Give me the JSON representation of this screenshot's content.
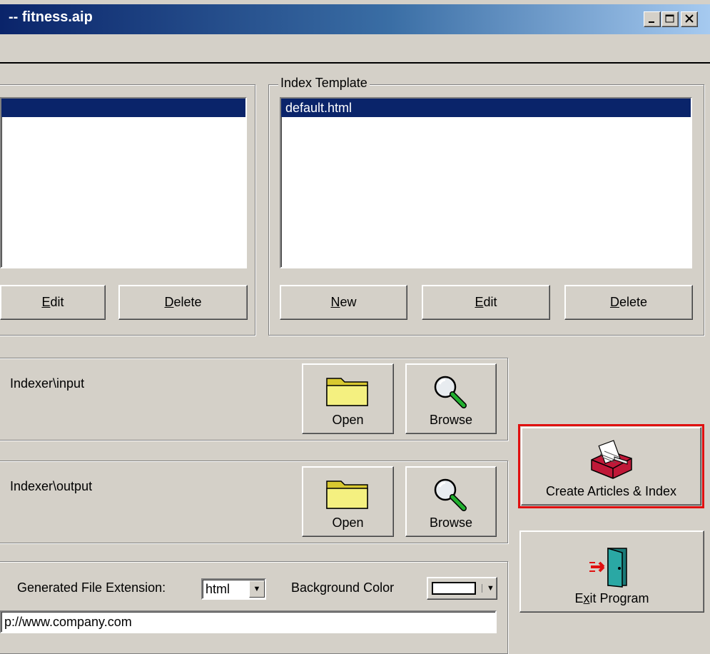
{
  "window": {
    "title": "-- fitness.aip"
  },
  "left_template": {
    "buttons": {
      "edit": {
        "ul": "E",
        "rest": "dit"
      },
      "delete": {
        "ul": "D",
        "rest": "elete"
      }
    }
  },
  "index_template": {
    "legend": "Index Template",
    "items": [
      "default.html"
    ],
    "selected": "default.html",
    "buttons": {
      "new": {
        "ul": "N",
        "rest": "ew"
      },
      "edit": {
        "ul": "E",
        "rest": "dit"
      },
      "delete": {
        "ul": "D",
        "rest": "elete"
      }
    }
  },
  "input_folder": {
    "path": "Indexer\\input",
    "open_label": "Open",
    "browse_label": "Browse"
  },
  "output_folder": {
    "path": "Indexer\\output",
    "open_label": "Open",
    "browse_label": "Browse"
  },
  "settings": {
    "ext_label": "Generated File Extension:",
    "ext_value": "html",
    "bg_color_label": "Background Color",
    "bg_color_value": "#ffffff",
    "url_value": "p://www.company.com"
  },
  "actions": {
    "create_label": "Create Articles & Index",
    "exit": {
      "pre": "E",
      "ul": "x",
      "rest": "it Program"
    }
  },
  "colors": {
    "highlight": "#e01010",
    "selection": "#0a246a"
  }
}
